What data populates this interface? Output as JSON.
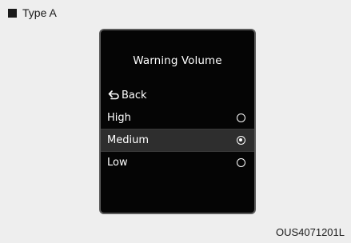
{
  "type_label": "Type A",
  "screen": {
    "title": "Warning Volume",
    "back_label": "Back",
    "back_icon": "return-arrow-icon",
    "options": [
      {
        "label": "High",
        "selected": false
      },
      {
        "label": "Medium",
        "selected": true
      },
      {
        "label": "Low",
        "selected": false
      }
    ]
  },
  "figure_code": "OUS4071201L",
  "colors": {
    "screen_bg": "#050505",
    "selected_row_bg": "#2e2e2e",
    "text": "#ffffff"
  }
}
